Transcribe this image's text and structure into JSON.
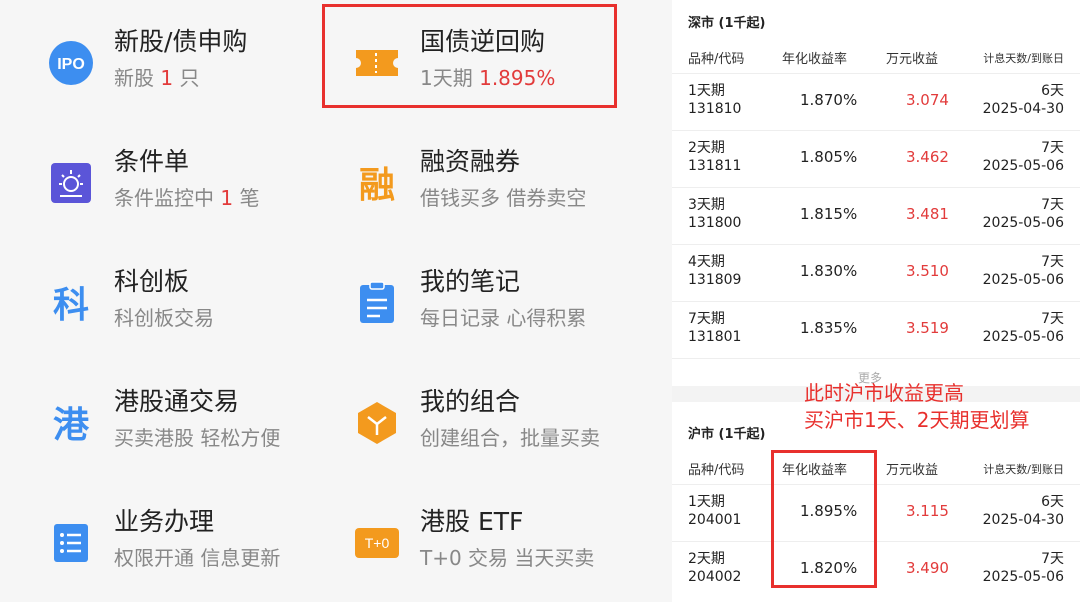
{
  "menu": [
    {
      "title": "新股/债申购",
      "sub_pre": "新股 ",
      "sub_hl": "1",
      "sub_post": " 只",
      "icon": "ipo-icon",
      "icon_text": "IPO"
    },
    {
      "title": "国债逆回购",
      "sub_pre": "1天期 ",
      "sub_hl": "1.895%",
      "sub_post": "",
      "icon": "ticket-icon"
    },
    {
      "title": "条件单",
      "sub_pre": "条件监控中 ",
      "sub_hl": "1",
      "sub_post": " 笔",
      "icon": "condition-order-icon"
    },
    {
      "title": "融资融券",
      "sub_pre": "借钱买多 借券卖空",
      "sub_hl": "",
      "sub_post": "",
      "icon": "margin-icon",
      "icon_text": "融"
    },
    {
      "title": "科创板",
      "sub_pre": "科创板交易",
      "sub_hl": "",
      "sub_post": "",
      "icon": "star-market-icon",
      "icon_text": "科"
    },
    {
      "title": "我的笔记",
      "sub_pre": "每日记录 心得积累",
      "sub_hl": "",
      "sub_post": "",
      "icon": "notes-icon"
    },
    {
      "title": "港股通交易",
      "sub_pre": "买卖港股 轻松方便",
      "sub_hl": "",
      "sub_post": "",
      "icon": "hk-connect-icon",
      "icon_text": "港"
    },
    {
      "title": "我的组合",
      "sub_pre": "创建组合，批量买卖",
      "sub_hl": "",
      "sub_post": "",
      "icon": "portfolio-icon"
    },
    {
      "title": "业务办理",
      "sub_pre": "权限开通 信息更新",
      "sub_hl": "",
      "sub_post": "",
      "icon": "business-icon"
    },
    {
      "title": "港股 ETF",
      "sub_pre": "T+0 交易 当天买卖",
      "sub_hl": "",
      "sub_post": "",
      "icon": "t0-icon",
      "icon_text": "T+0"
    }
  ],
  "shenzhen": {
    "title": "深市 (1千起)",
    "headers": [
      "品种/代码",
      "年化收益率",
      "万元收益",
      "计息天数/到账日"
    ],
    "rows": [
      {
        "name": "1天期",
        "code": "131810",
        "rate": "1.870%",
        "gain": "3.074",
        "days": "6天",
        "date": "2025-04-30"
      },
      {
        "name": "2天期",
        "code": "131811",
        "rate": "1.805%",
        "gain": "3.462",
        "days": "7天",
        "date": "2025-05-06"
      },
      {
        "name": "3天期",
        "code": "131800",
        "rate": "1.815%",
        "gain": "3.481",
        "days": "7天",
        "date": "2025-05-06"
      },
      {
        "name": "4天期",
        "code": "131809",
        "rate": "1.830%",
        "gain": "3.510",
        "days": "7天",
        "date": "2025-05-06"
      },
      {
        "name": "7天期",
        "code": "131801",
        "rate": "1.835%",
        "gain": "3.519",
        "days": "7天",
        "date": "2025-05-06"
      }
    ],
    "more": "更多"
  },
  "shanghai": {
    "title": "沪市 (1千起)",
    "headers": [
      "品种/代码",
      "年化收益率",
      "万元收益",
      "计息天数/到账日"
    ],
    "rows": [
      {
        "name": "1天期",
        "code": "204001",
        "rate": "1.895%",
        "gain": "3.115",
        "days": "6天",
        "date": "2025-04-30"
      },
      {
        "name": "2天期",
        "code": "204002",
        "rate": "1.820%",
        "gain": "3.490",
        "days": "7天",
        "date": "2025-05-06"
      }
    ]
  },
  "annotation": {
    "line1": "此时沪市收益更高",
    "line2": "买沪市1天、2天期更划算"
  },
  "colors": {
    "accent_red": "#e8302d",
    "value_red": "#e23b3b",
    "ipo_blue": "#3d8ef0",
    "orange": "#f39a1e",
    "purple": "#5b55d8"
  }
}
